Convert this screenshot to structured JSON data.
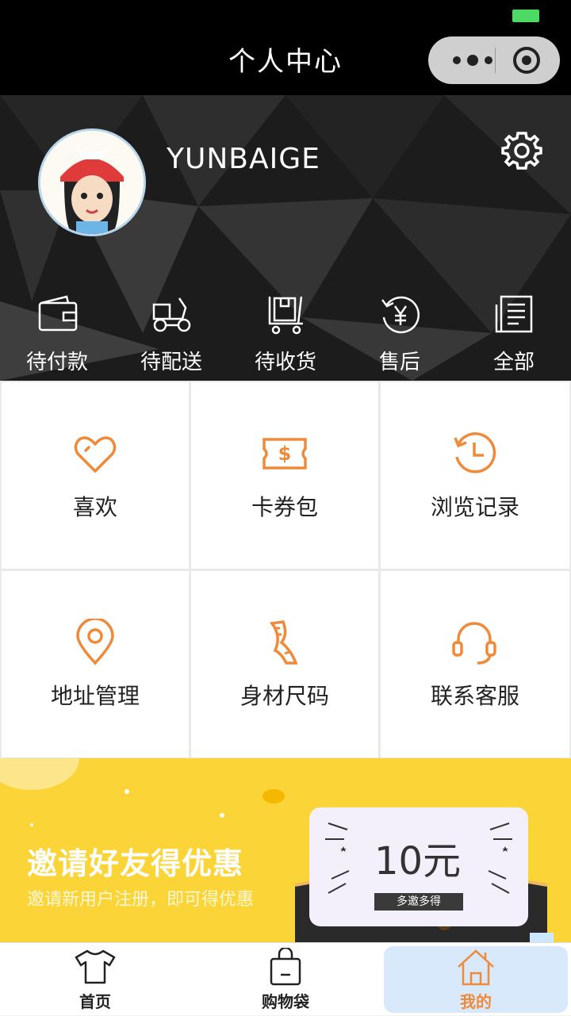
{
  "nav": {
    "title": "个人中心"
  },
  "profile": {
    "username": "YUNBAIGE"
  },
  "orders": [
    {
      "label": "待付款",
      "icon": "wallet-icon"
    },
    {
      "label": "待配送",
      "icon": "delivery-icon"
    },
    {
      "label": "待收货",
      "icon": "cart-icon"
    },
    {
      "label": "售后",
      "icon": "refund-icon"
    },
    {
      "label": "全部",
      "icon": "orders-list-icon"
    }
  ],
  "grid": [
    {
      "label": "喜欢",
      "icon": "heart-icon"
    },
    {
      "label": "卡券包",
      "icon": "coupon-icon"
    },
    {
      "label": "浏览记录",
      "icon": "history-icon"
    },
    {
      "label": "地址管理",
      "icon": "location-pin-icon"
    },
    {
      "label": "身材尺码",
      "icon": "measuring-tape-icon"
    },
    {
      "label": "联系客服",
      "icon": "headset-icon"
    }
  ],
  "banner": {
    "title": "邀请好友得优惠",
    "subtitle": "邀请新用户注册，即可得优惠",
    "amount": "10元",
    "tag": "多邀多得"
  },
  "tabs": [
    {
      "label": "首页",
      "icon": "tshirt-icon"
    },
    {
      "label": "购物袋",
      "icon": "shopping-bag-icon"
    },
    {
      "label": "我的",
      "icon": "home-icon"
    }
  ],
  "colors": {
    "accent": "#ef8a3a",
    "banner": "#fbd437",
    "active_tab_bg": "#d7e9fb"
  }
}
